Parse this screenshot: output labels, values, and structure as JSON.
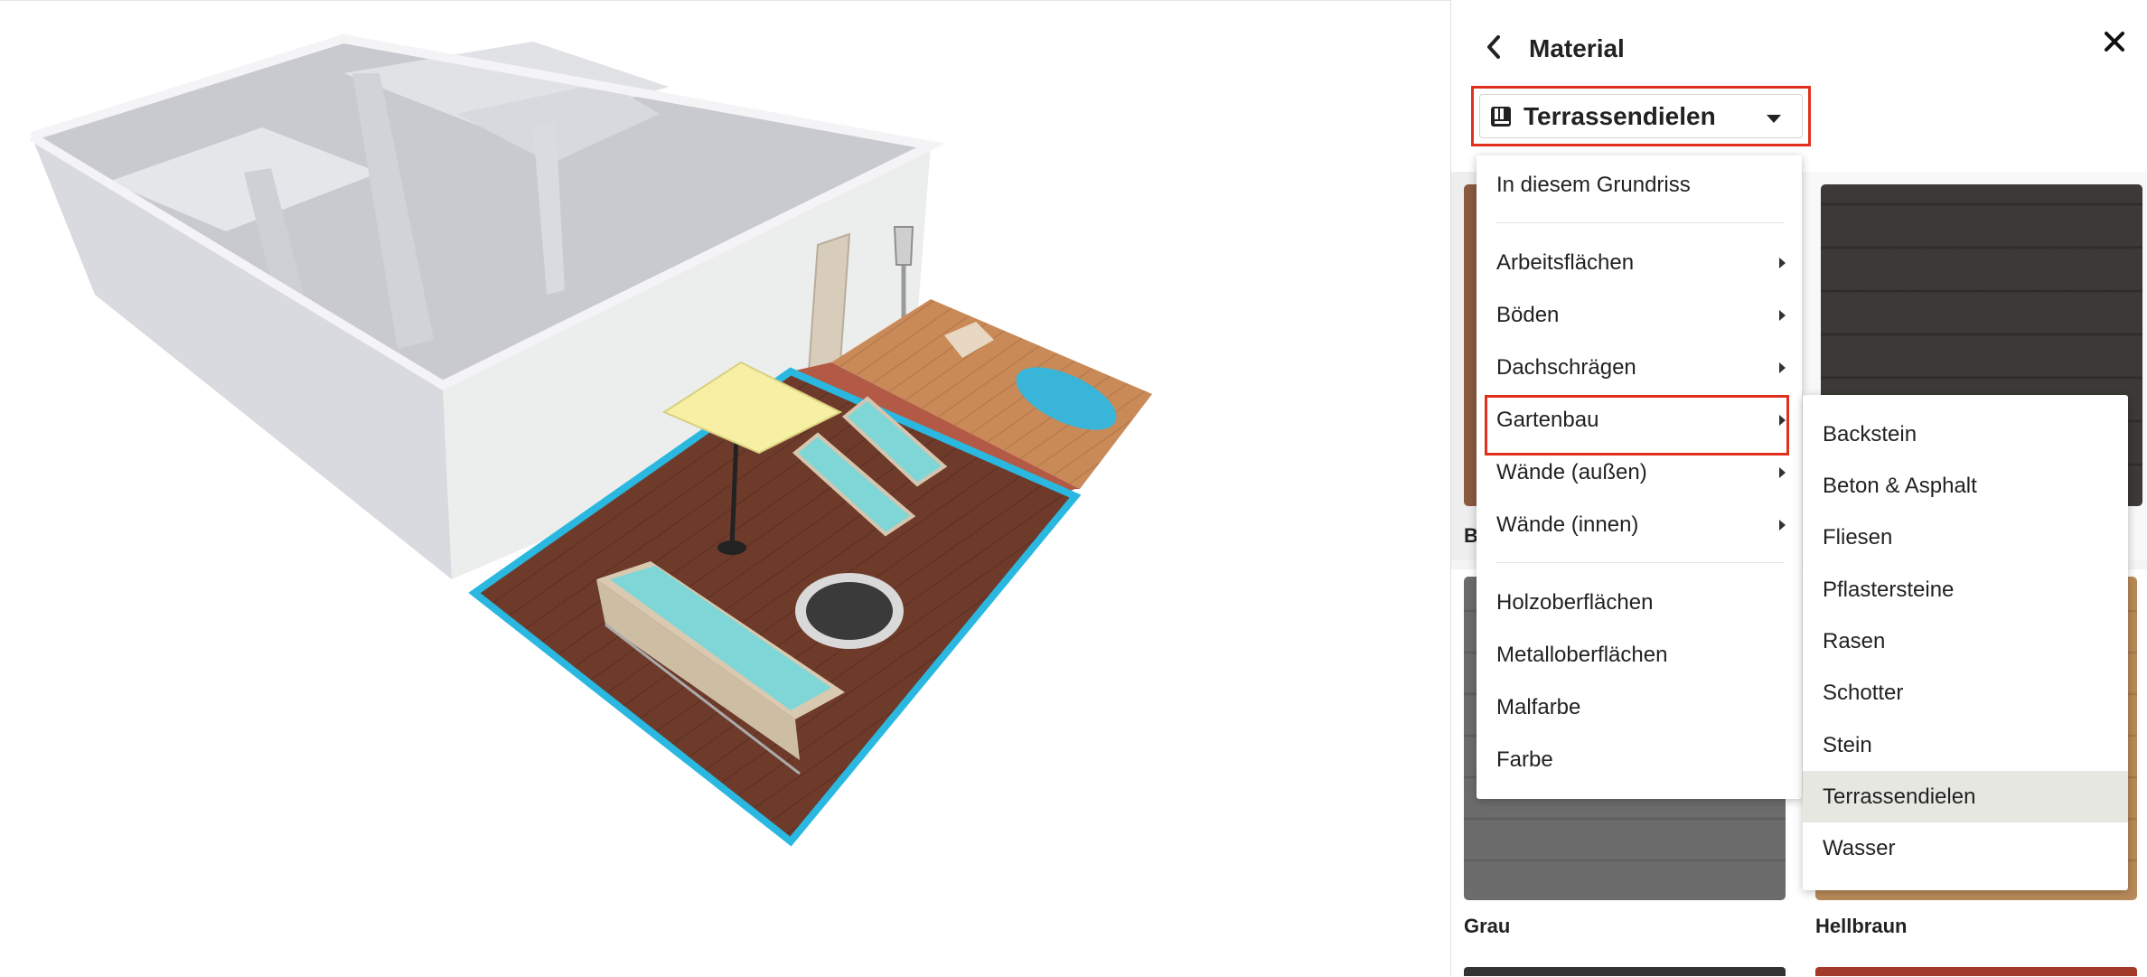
{
  "panel": {
    "title": "Material",
    "selected_category": "Terrassendielen"
  },
  "menu": {
    "top_items": [
      {
        "label": "In diesem Grundriss",
        "has_submenu": false
      }
    ],
    "group_items": [
      {
        "label": "Arbeitsflächen",
        "has_submenu": true
      },
      {
        "label": "Böden",
        "has_submenu": true
      },
      {
        "label": "Dachschrägen",
        "has_submenu": true
      },
      {
        "label": "Gartenbau",
        "has_submenu": true,
        "active": true
      },
      {
        "label": "Wände (außen)",
        "has_submenu": true
      },
      {
        "label": "Wände (innen)",
        "has_submenu": true
      }
    ],
    "bottom_items": [
      {
        "label": "Holzoberflächen",
        "has_submenu": false
      },
      {
        "label": "Metalloberflächen",
        "has_submenu": false
      },
      {
        "label": "Malfarbe",
        "has_submenu": false
      },
      {
        "label": "Farbe",
        "has_submenu": false
      }
    ]
  },
  "submenu": {
    "items": [
      {
        "label": "Backstein"
      },
      {
        "label": "Beton & Asphalt"
      },
      {
        "label": "Fliesen"
      },
      {
        "label": "Pflastersteine"
      },
      {
        "label": "Rasen"
      },
      {
        "label": "Schotter"
      },
      {
        "label": "Stein"
      },
      {
        "label": "Terrassendielen",
        "selected": true
      },
      {
        "label": "Wasser"
      }
    ]
  },
  "tiles": [
    {
      "label": "B",
      "color": "#8a5a40"
    },
    {
      "label": "",
      "color": "#3b3a36"
    },
    {
      "label": "Grau",
      "color": "#6c6c6c"
    },
    {
      "label": "Hellbraun",
      "color": "#b88a5a"
    }
  ],
  "colors": {
    "highlight": "#e0311d",
    "selection_outline": "#2ab8e0",
    "deck": "#6b3a2a",
    "cushion": "#7fd6d6"
  },
  "icons": {
    "back": "chevron-left-icon",
    "close": "close-icon",
    "category": "material-swatch-icon",
    "caret": "caret-down-icon"
  }
}
